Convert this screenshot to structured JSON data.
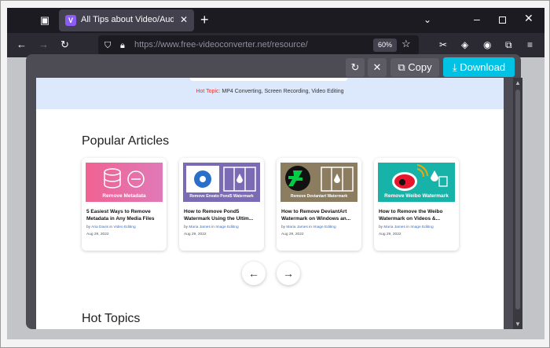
{
  "browser": {
    "tab_title": "All Tips about Video/Audio Con",
    "url": "https://www.free-videoconverter.net/resource/",
    "zoom": "60%"
  },
  "modal": {
    "copy_label": "Copy",
    "download_label": "Download"
  },
  "page": {
    "hot_topic_label": "Hot Topic:",
    "hot_topic_items": "MP4 Converting, Screen Recording, Video Editing",
    "popular_heading": "Popular Articles",
    "hot_topics_heading": "Hot Topics",
    "articles": [
      {
        "thumb_caption": "Remove Metadata",
        "title": "5 Easiest Ways to Remove Metadata in Any Media Files",
        "by": "by",
        "author": "Aria Davis",
        "in": "in",
        "category": "Video Editing",
        "date": "Aug 29, 2022",
        "thumb_color": "#e8559a"
      },
      {
        "thumb_caption": "Remove Envato Pond5 Watermark",
        "title": "How to Remove Pond5 Watermark Using the Ultim...",
        "by": "by",
        "author": "Maria James",
        "in": "in",
        "category": "Image Editing",
        "date": "Aug 29, 2022",
        "thumb_color": "#7b6bb5"
      },
      {
        "thumb_caption": "Remove Deviantart Watermark",
        "title": "How to Remove DeviantArt Watermark on Windows an...",
        "by": "by",
        "author": "Maria James",
        "in": "in",
        "category": "Image Editing",
        "date": "Aug 29, 2022",
        "thumb_color": "#8c7d60"
      },
      {
        "thumb_caption": "Remove Weibo Watermark",
        "title": "How to Remove the Weibo Watermark on Videos &...",
        "by": "by",
        "author": "Maria James",
        "in": "in",
        "category": "Image Editing",
        "date": "Aug 29, 2022",
        "thumb_color": "#17b3a8"
      }
    ]
  },
  "colors": {
    "accent": "#00c2e5",
    "titlebar": "#1c1b22",
    "hotbar": "#dce8fb"
  }
}
